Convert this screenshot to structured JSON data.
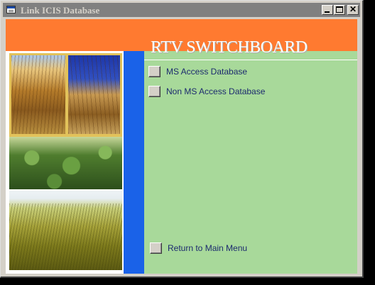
{
  "window": {
    "title": "Link ICIS Database",
    "controls": {
      "minimize_icon": "minimize-icon",
      "maximize_icon": "maximize-icon",
      "close_glyph": "✕"
    }
  },
  "header": {
    "title": "RTV SWITCHBOARD"
  },
  "menu": {
    "items": [
      {
        "label": "MS Access Database"
      },
      {
        "label": "Non MS Access Database"
      }
    ],
    "return_label": "Return to Main Menu"
  },
  "colors": {
    "header_band": "#ff7a30",
    "form_background": "#a8d99a",
    "accent_bar": "#1a62e8",
    "title_bar_inactive": "#808080"
  }
}
